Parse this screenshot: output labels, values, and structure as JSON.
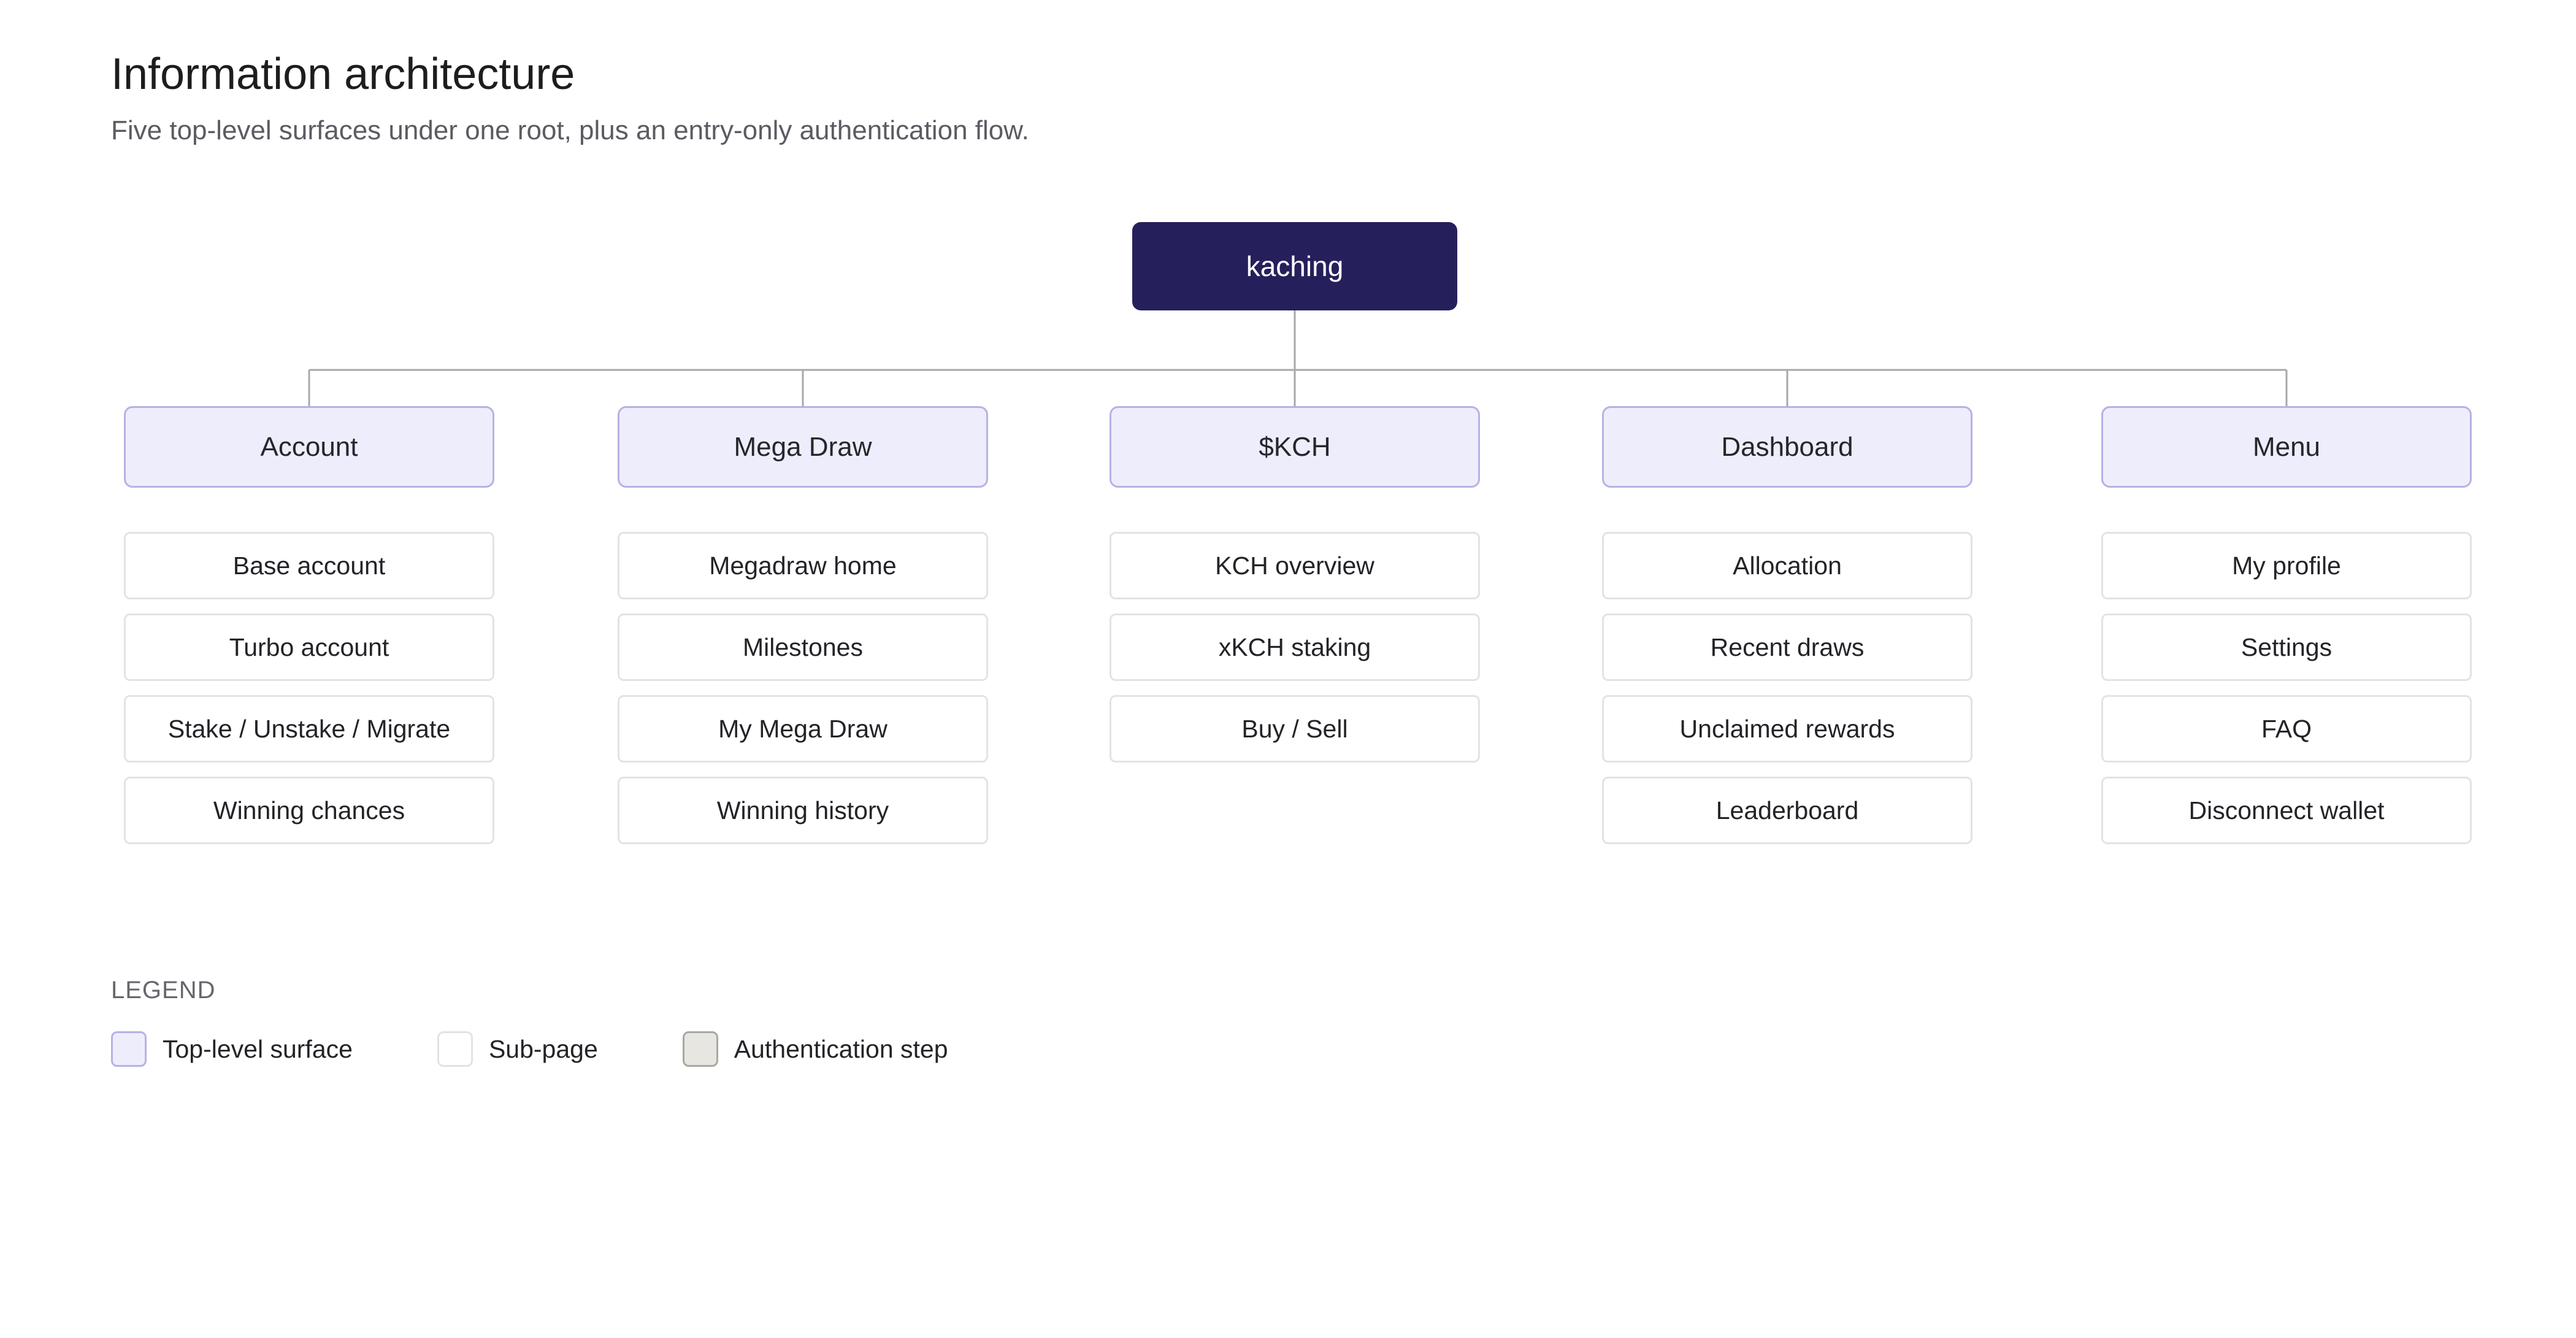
{
  "header": {
    "title": "Information architecture",
    "subtitle": "Five top-level surfaces under one root, plus an entry-only authentication flow."
  },
  "root": {
    "label": "kaching"
  },
  "surfaces": [
    {
      "label": "Account",
      "subpages": [
        "Base account",
        "Turbo account",
        "Stake / Unstake / Migrate",
        "Winning chances"
      ]
    },
    {
      "label": "Mega Draw",
      "subpages": [
        "Megadraw home",
        "Milestones",
        "My Mega Draw",
        "Winning history"
      ]
    },
    {
      "label": "$KCH",
      "subpages": [
        "KCH overview",
        "xKCH staking",
        "Buy / Sell"
      ]
    },
    {
      "label": "Dashboard",
      "subpages": [
        "Allocation",
        "Recent draws",
        "Unclaimed rewards",
        "Leaderboard"
      ]
    },
    {
      "label": "Menu",
      "subpages": [
        "My profile",
        "Settings",
        "FAQ",
        "Disconnect wallet"
      ]
    }
  ],
  "legend": {
    "title": "LEGEND",
    "items": [
      {
        "label": "Top-level surface"
      },
      {
        "label": "Sub-page"
      },
      {
        "label": "Authentication step"
      }
    ]
  },
  "colors": {
    "root_fill": "#25205b",
    "surface_fill": "#eeedfb",
    "surface_border": "#b6b2e6",
    "subpage_border": "#e3e3e6",
    "auth_fill": "#e7e6e1",
    "connector": "#a8a8ad"
  }
}
